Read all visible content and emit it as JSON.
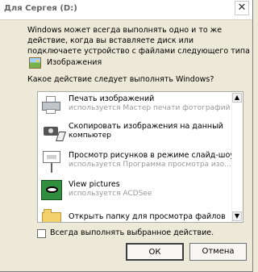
{
  "window": {
    "title": "Для Сергея (D:)",
    "close_glyph": "✕"
  },
  "intro_text": "Windows может всегда выполнять одно и то же действие, когда вы вставляете диск или подключаете устройство с файлами следующего типа",
  "content_type": {
    "label": "Изображения",
    "icon": "images-icon"
  },
  "question": "Какое действие следует выполнять Windows?",
  "actions": [
    {
      "title": "Печать изображений",
      "subtitle": "используется Мастер печати фотографий",
      "icon": "printer-icon"
    },
    {
      "title": "Скопировать изображения на данный",
      "subtitle": "компьютер",
      "icon": "camera-copy-icon"
    },
    {
      "title": "Просмотр рисунков в режиме слайд-шоу",
      "subtitle": "используется Программа просмотра изо...",
      "icon": "slideshow-icon"
    },
    {
      "title": "View pictures",
      "subtitle": "используется ACDSee",
      "icon": "acdsee-icon"
    },
    {
      "title": "Открыть папку для просмотра файлов",
      "subtitle": "",
      "icon": "folder-icon"
    }
  ],
  "scroll": {
    "up": "▲",
    "down": "▼"
  },
  "checkbox_label": "Всегда выполнять выбранное действие.",
  "buttons": {
    "ok": "ОК",
    "cancel": "Отмена"
  }
}
